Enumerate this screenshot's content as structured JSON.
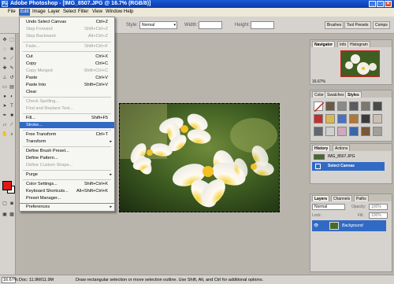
{
  "window": {
    "title": "Adobe Photoshop - [IMG_8507.JPG @ 16.7% (RGB/8)]",
    "app_icon": "Ps",
    "minimize": "_",
    "restore": "□",
    "close": "✕"
  },
  "menubar": {
    "items": [
      "File",
      "Edit",
      "Image",
      "Layer",
      "Select",
      "Filter",
      "View",
      "Window",
      "Help"
    ],
    "active": "Edit"
  },
  "options": {
    "style_label": "Style:",
    "style_value": "Normal",
    "width_label": "Width:",
    "height_label": "Height:"
  },
  "palette_well": {
    "tabs": [
      "Brushes",
      "Tool Presets",
      "Comps"
    ]
  },
  "edit_menu": {
    "items": [
      {
        "label": "Undo Select Canvas",
        "shortcut": "Ctrl+Z",
        "disabled": false
      },
      {
        "label": "Step Forward",
        "shortcut": "Shift+Ctrl+Z",
        "disabled": true
      },
      {
        "label": "Step Backward",
        "shortcut": "Alt+Ctrl+Z",
        "disabled": true
      },
      {
        "label": "Fade...",
        "shortcut": "Shift+Ctrl+F",
        "disabled": true
      },
      {
        "label": "Cut",
        "shortcut": "Ctrl+X",
        "disabled": false
      },
      {
        "label": "Copy",
        "shortcut": "Ctrl+C",
        "disabled": false
      },
      {
        "label": "Copy Merged",
        "shortcut": "Shift+Ctrl+C",
        "disabled": true
      },
      {
        "label": "Paste",
        "shortcut": "Ctrl+V",
        "disabled": false
      },
      {
        "label": "Paste Into",
        "shortcut": "Shift+Ctrl+V",
        "disabled": false
      },
      {
        "label": "Clear",
        "shortcut": "",
        "disabled": false
      },
      {
        "label": "Check Spelling...",
        "shortcut": "",
        "disabled": true
      },
      {
        "label": "Find and Replace Text...",
        "shortcut": "",
        "disabled": true
      },
      {
        "label": "Fill...",
        "shortcut": "Shift+F5",
        "disabled": false
      },
      {
        "label": "Stroke...",
        "shortcut": "",
        "disabled": false,
        "highlighted": true
      },
      {
        "label": "Free Transform",
        "shortcut": "Ctrl+T",
        "disabled": false
      },
      {
        "label": "Transform",
        "shortcut": "",
        "disabled": false,
        "submenu": true
      },
      {
        "label": "Define Brush Preset...",
        "shortcut": "",
        "disabled": false
      },
      {
        "label": "Define Pattern...",
        "shortcut": "",
        "disabled": false
      },
      {
        "label": "Define Custom Shape...",
        "shortcut": "",
        "disabled": true
      },
      {
        "label": "Purge",
        "shortcut": "",
        "disabled": false,
        "submenu": true
      },
      {
        "label": "Color Settings...",
        "shortcut": "Shift+Ctrl+K",
        "disabled": false
      },
      {
        "label": "Keyboard Shortcuts...",
        "shortcut": "Alt+Shift+Ctrl+K",
        "disabled": false
      },
      {
        "label": "Preset Manager...",
        "shortcut": "",
        "disabled": false
      },
      {
        "label": "Preferences",
        "shortcut": "",
        "disabled": false,
        "submenu": true
      }
    ]
  },
  "navigator": {
    "tabs": [
      "Navigator",
      "Info",
      "Histogram"
    ],
    "zoom": "16.67%"
  },
  "styles_panel": {
    "tabs": [
      "Color",
      "Swatches",
      "Styles"
    ]
  },
  "history": {
    "tabs": [
      "History",
      "Actions"
    ],
    "snapshot": "IMG_8507.JPG",
    "state": "Select Canvas"
  },
  "layers": {
    "tabs": [
      "Layers",
      "Channels",
      "Paths"
    ],
    "blend_mode": "Normal",
    "opacity_label": "Opacity:",
    "opacity": "100%",
    "lock_label": "Lock:",
    "fill_label": "Fill:",
    "fill": "100%",
    "layer_name": "Background"
  },
  "status": {
    "zoom": "16.67%",
    "doc": "Doc: 11.9M/11.9M",
    "hint": "Draw rectangular selection or move selection outline. Use Shift, Alt, and Ctrl for additional options."
  },
  "icons": {
    "close": "✕",
    "submenu": "▸",
    "dropdown": "▾",
    "eye": "👁"
  },
  "colors": {
    "foreground": "#e01818",
    "background": "#ffffff",
    "highlight": "#316ac5"
  }
}
